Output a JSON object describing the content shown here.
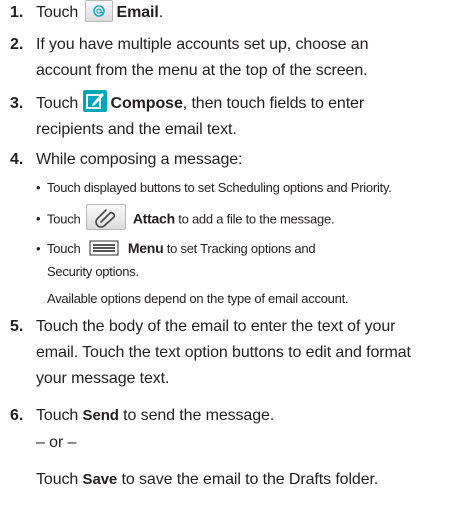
{
  "steps": [
    {
      "num": "1.",
      "before": "Touch ",
      "bold": "Email",
      "after": "."
    },
    {
      "num": "2.",
      "line1": "If you have multiple accounts set up, choose an",
      "line2": "account from the menu at the top of the screen."
    },
    {
      "num": "3.",
      "before": "Touch ",
      "bold": "Compose",
      "after": ", then touch fields to enter",
      "line2": "recipients and the email text."
    },
    {
      "num": "4.",
      "text": "While composing a message:"
    },
    {
      "num": "5.",
      "line1": "Touch the body of the email to enter the text of your",
      "line2": "email. Touch the text option buttons to edit and format",
      "line3": "your message text."
    },
    {
      "num": "6.",
      "before": "Touch ",
      "bold": "Send",
      "after": " to send the message.",
      "or": "– or –",
      "alt_before": "Touch ",
      "alt_bold": "Save",
      "alt_after": " to save the email to the Drafts folder."
    }
  ],
  "substeps": [
    {
      "text": "Touch displayed buttons to set Scheduling options and Priority."
    },
    {
      "before": "Touch ",
      "bold": "Attach",
      "after": " to add a file to the message."
    },
    {
      "before": "Touch ",
      "bold": "Menu",
      "after": " to set Tracking options and",
      "line2": "Security options."
    }
  ],
  "note": "Available options depend on the type of email account.",
  "bullet_char": "•",
  "icons": [
    "email-icon",
    "compose-icon",
    "attach-icon",
    "menu-icon"
  ],
  "colors": {
    "text": "#231f20",
    "compose_icon": "#00a6b8",
    "email_icon": "#22a9c9"
  }
}
